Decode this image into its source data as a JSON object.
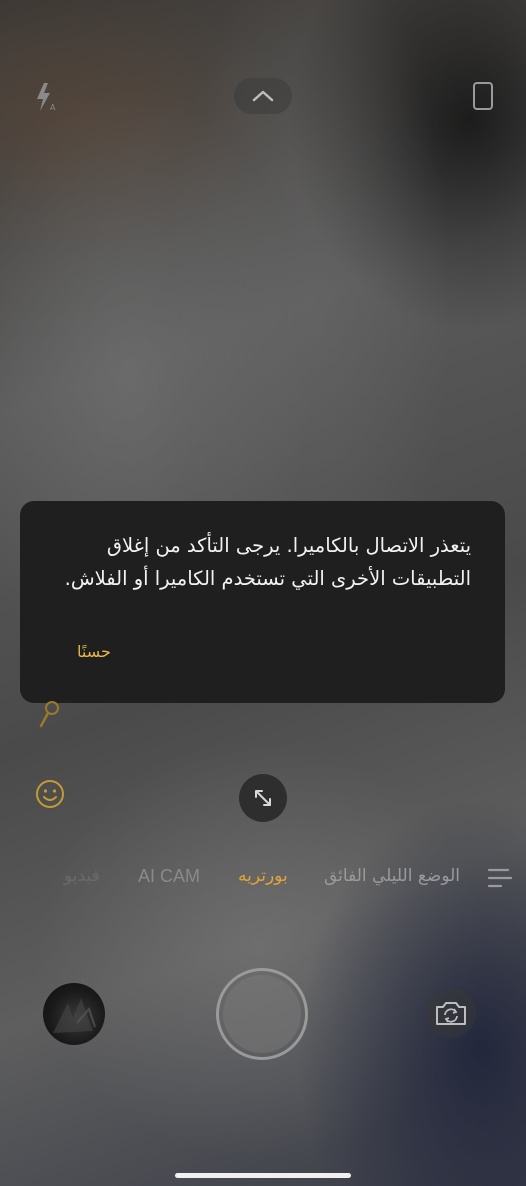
{
  "camera": {
    "flash_mode": "A",
    "dialog": {
      "message": "يتعذر الاتصال بالكاميرا. يرجى التأكد من إغلاق التطبيقات الأخرى التي تستخدم الكاميرا أو الفلاش.",
      "ok_label": "حسنًا"
    },
    "modes": {
      "video": "فيديو",
      "ai_cam": "AI CAM",
      "portrait": "بورتريه",
      "night": "الوضع الليلي الفائق"
    },
    "active_mode": "portrait"
  },
  "colors": {
    "accent": "#e0a33a",
    "dialog_bg": "#1f1f1f"
  },
  "icons": [
    "flash-auto-icon",
    "chevron-up-icon",
    "aspect-ratio-icon",
    "filter-icon",
    "emoji-icon",
    "expand-icon",
    "menu-lines-icon",
    "switch-camera-icon"
  ]
}
